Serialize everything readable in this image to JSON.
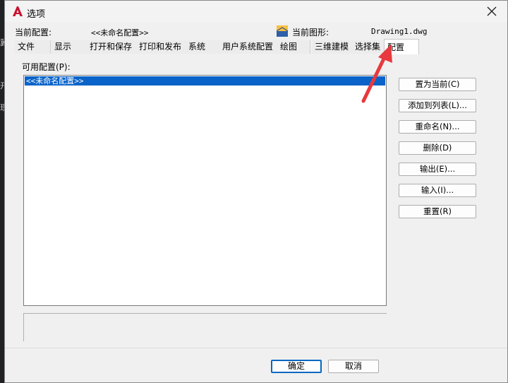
{
  "dialog": {
    "title": "选项",
    "close_symbol": "✕"
  },
  "info": {
    "profile_label": "当前配置:",
    "profile_value": "<<未命名配置>>",
    "drawing_label": "当前图形:",
    "drawing_value": "Drawing1.dwg"
  },
  "tabs": [
    {
      "label": "文件"
    },
    {
      "label": "显示"
    },
    {
      "label": "打开和保存"
    },
    {
      "label": "打印和发布"
    },
    {
      "label": "系统"
    },
    {
      "label": "用户系统配置"
    },
    {
      "label": "绘图"
    },
    {
      "label": "三维建模"
    },
    {
      "label": "选择集"
    },
    {
      "label": "配置",
      "active": true
    }
  ],
  "profiles": {
    "label": "可用配置(P):",
    "items": [
      "<<未命名配置>>"
    ]
  },
  "side_buttons": [
    "置为当前(C)",
    "添加到列表(L)...",
    "重命名(N)...",
    "删除(D)",
    "输出(E)...",
    "输入(I)...",
    "重置(R)"
  ],
  "footer": {
    "ok": "确定",
    "cancel": "取消"
  },
  "background": {
    "char_1": "开",
    "char_2": "现",
    "char_3": "冀"
  },
  "colors": {
    "selection": "#0a63c9",
    "annotation_arrow": "#e8393e",
    "app_icon": "#c8102e"
  }
}
